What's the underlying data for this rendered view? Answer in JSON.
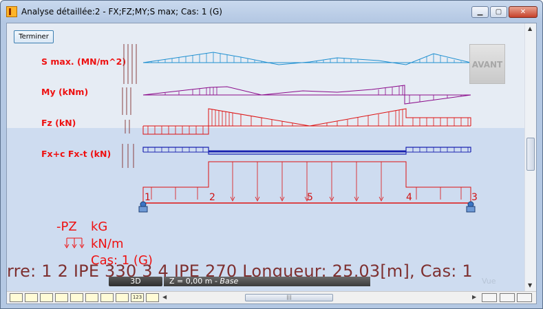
{
  "window": {
    "title": "Analyse détaillée:2 - FX;FZ;MY;S max; Cas: 1 (G)",
    "minimize_glyph": "▁",
    "maximize_glyph": "▢",
    "close_glyph": "✕"
  },
  "toolbar": {
    "terminer_label": "Terminer"
  },
  "diagrams": {
    "smax_label": "S max. (MN/m^2)",
    "my_label": "My  (kNm)",
    "fz_label": "Fz  (kN)",
    "fx_label": "Fx+c Fx-t  (kN)"
  },
  "avant_label": "AVANT",
  "node_labels": [
    "1",
    "2",
    "5",
    "4",
    "3"
  ],
  "legend": {
    "direction": "-PZ",
    "unit_force": "kG",
    "unit_load": "kN/m",
    "case": "Cas: 1 (G)"
  },
  "footer_info": "rre: 1 2   IPE 330  3 4   IPE 270  Longueur: 25,03[m], Cas: 1",
  "view": {
    "mode_label": "3D",
    "z_prefix": "Z = 0,00 m - ",
    "z_base": "Base",
    "vue_label": "Vue"
  },
  "bottom_tools": [
    "dim",
    "beam",
    "chk",
    "stat",
    "pen",
    "ruler",
    "plate",
    "slab",
    "123",
    "grid"
  ],
  "colors": {
    "labels": "#ee1111",
    "smax": "#1e8fd0",
    "my": "#8a0a8a",
    "fz": "#dd1111",
    "fx": "#1a22b0",
    "loads": "#dd1111",
    "support": "#3a74c4"
  }
}
